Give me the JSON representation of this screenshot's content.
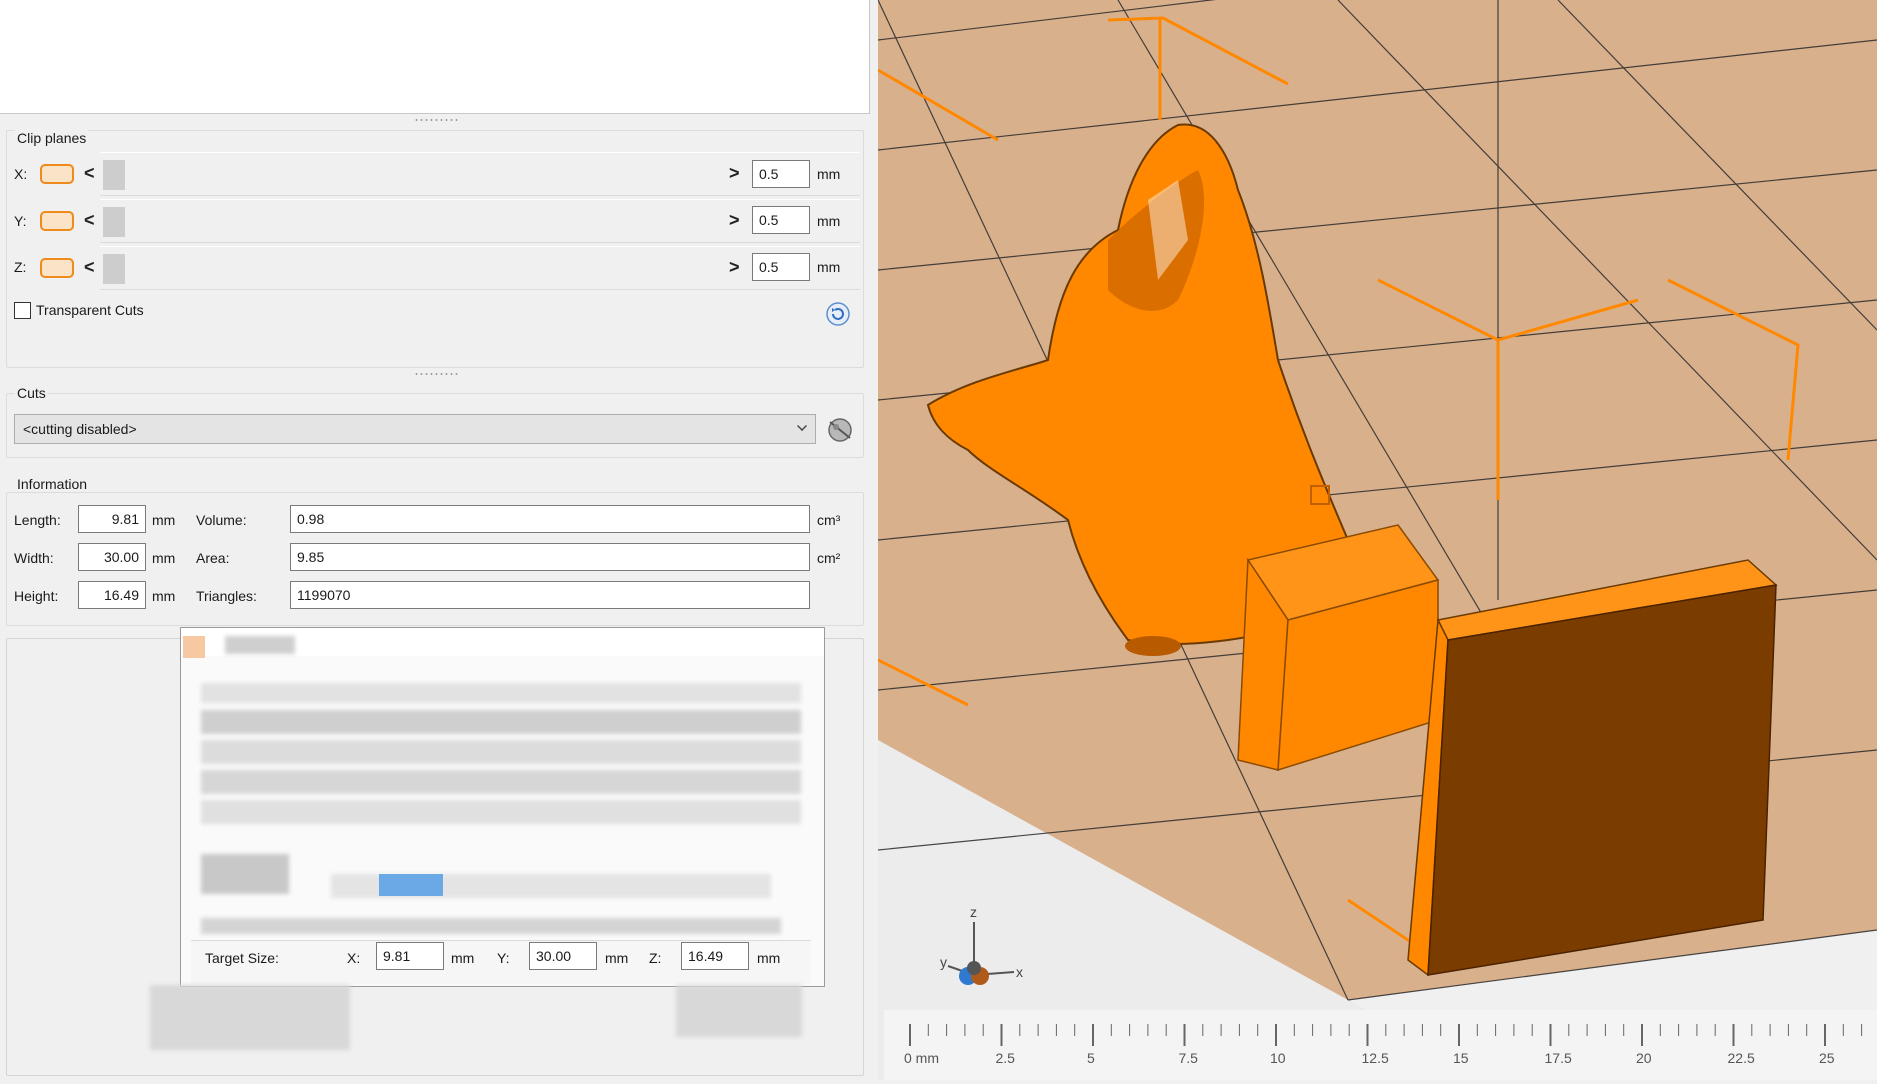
{
  "clip_planes": {
    "title": "Clip planes",
    "rows": [
      {
        "axis": "X:",
        "value": "0.5",
        "unit": "mm"
      },
      {
        "axis": "Y:",
        "value": "0.5",
        "unit": "mm"
      },
      {
        "axis": "Z:",
        "value": "0.5",
        "unit": "mm"
      }
    ],
    "transparent_cuts_label": "Transparent Cuts",
    "transparent_cuts_checked": false,
    "left_arrow": "<",
    "right_arrow": ">"
  },
  "cuts": {
    "title": "Cuts",
    "selected": "<cutting disabled>"
  },
  "information": {
    "title": "Information",
    "length_label": "Length:",
    "length_value": "9.81",
    "length_unit": "mm",
    "width_label": "Width:",
    "width_value": "30.00",
    "width_unit": "mm",
    "height_label": "Height:",
    "height_value": "16.49",
    "height_unit": "mm",
    "volume_label": "Volume:",
    "volume_value": "0.98",
    "volume_unit": "cm³",
    "area_label": "Area:",
    "area_value": "9.85",
    "area_unit": "cm²",
    "triangles_label": "Triangles:",
    "triangles_value": "1199070"
  },
  "dialog": {
    "target_size_label": "Target Size:",
    "x_label": "X:",
    "x_value": "9.81",
    "x_unit": "mm",
    "y_label": "Y:",
    "y_value": "30.00",
    "y_unit": "mm",
    "z_label": "Z:",
    "z_value": "16.49",
    "z_unit": "mm"
  },
  "viewport": {
    "model_color": "#ff8800",
    "bed_color": "#d9b08c",
    "axis_labels": {
      "x": "x",
      "y": "y",
      "z": "z"
    }
  },
  "ruler": {
    "labels": [
      "0 mm",
      "2.5",
      "5",
      "7.5",
      "10",
      "12.5",
      "15",
      "17.5",
      "20",
      "22.5",
      "25"
    ]
  }
}
